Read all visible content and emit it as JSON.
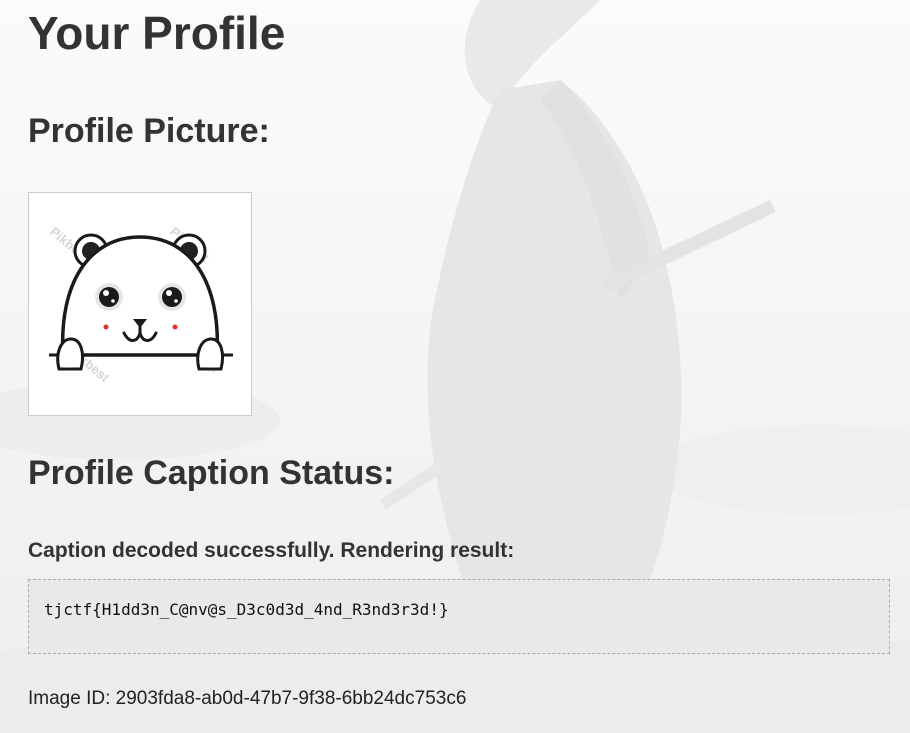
{
  "page": {
    "title": "Your Profile"
  },
  "profile_picture": {
    "heading": "Profile Picture:",
    "watermark": "Pikbest"
  },
  "caption": {
    "heading": "Profile Caption Status:",
    "status_text": "Caption decoded successfully. Rendering result:",
    "result_text": "tjctf{H1dd3n_C@nv@s_D3c0d3d_4nd_R3nd3r3d!}"
  },
  "footer": {
    "image_id_label": "Image ID:",
    "image_id_value": "2903fda8-ab0d-47b7-9f38-6bb24dc753c6"
  },
  "colors": {
    "background": "#f6f6f6",
    "heading_text": "#333333",
    "result_box_bg": "#e8e8e8",
    "result_box_border": "#aaaaaa",
    "cheek_red": "#e0302a"
  }
}
